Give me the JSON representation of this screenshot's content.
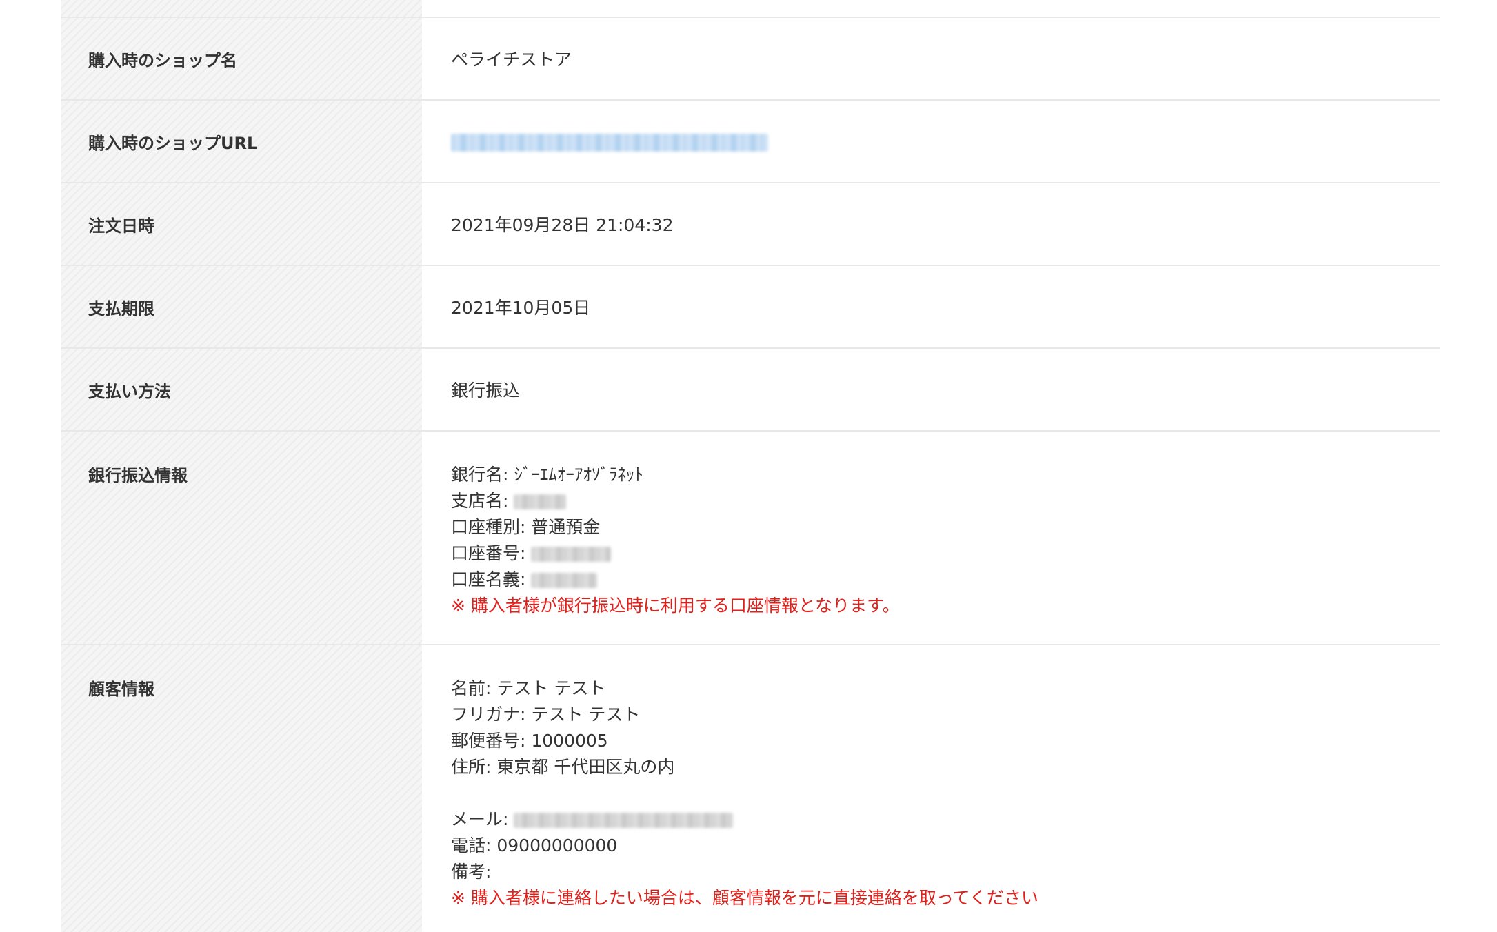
{
  "rows": {
    "shop_name": {
      "label": "購入時のショップ名",
      "value": "ペライチストア"
    },
    "shop_url": {
      "label": "購入時のショップURL",
      "value": ""
    },
    "order_datetime": {
      "label": "注文日時",
      "value": "2021年09月28日 21:04:32"
    },
    "payment_deadline": {
      "label": "支払期限",
      "value": "2021年10月05日"
    },
    "payment_method": {
      "label": "支払い方法",
      "value": "銀行振込"
    },
    "bank_info": {
      "label": "銀行振込情報",
      "bank_name": "銀行名: ｼﾞｰｴﾑｵｰｱｵｿﾞﾗﾈｯﾄ",
      "branch_label": "支店名:",
      "account_type": "口座種別: 普通預金",
      "account_number_label": "口座番号:",
      "account_holder_label": "口座名義:",
      "notice": "※ 購入者様が銀行振込時に利用する口座情報となります。"
    },
    "customer_info": {
      "label": "顧客情報",
      "name": "名前: テスト テスト",
      "furigana": "フリガナ: テスト テスト",
      "postal_code": "郵便番号: 1000005",
      "address": "住所: 東京都 千代田区丸の内",
      "email_label": "メール:",
      "phone": "電話: 09000000000",
      "note": "備考:",
      "notice": "※ 購入者様に連絡したい場合は、顧客情報を元に直接連絡を取ってください"
    }
  },
  "colors": {
    "label_bg": "#f5f5f5",
    "border": "#e8e8e8",
    "notice": "#e0201b",
    "text": "#333333"
  }
}
